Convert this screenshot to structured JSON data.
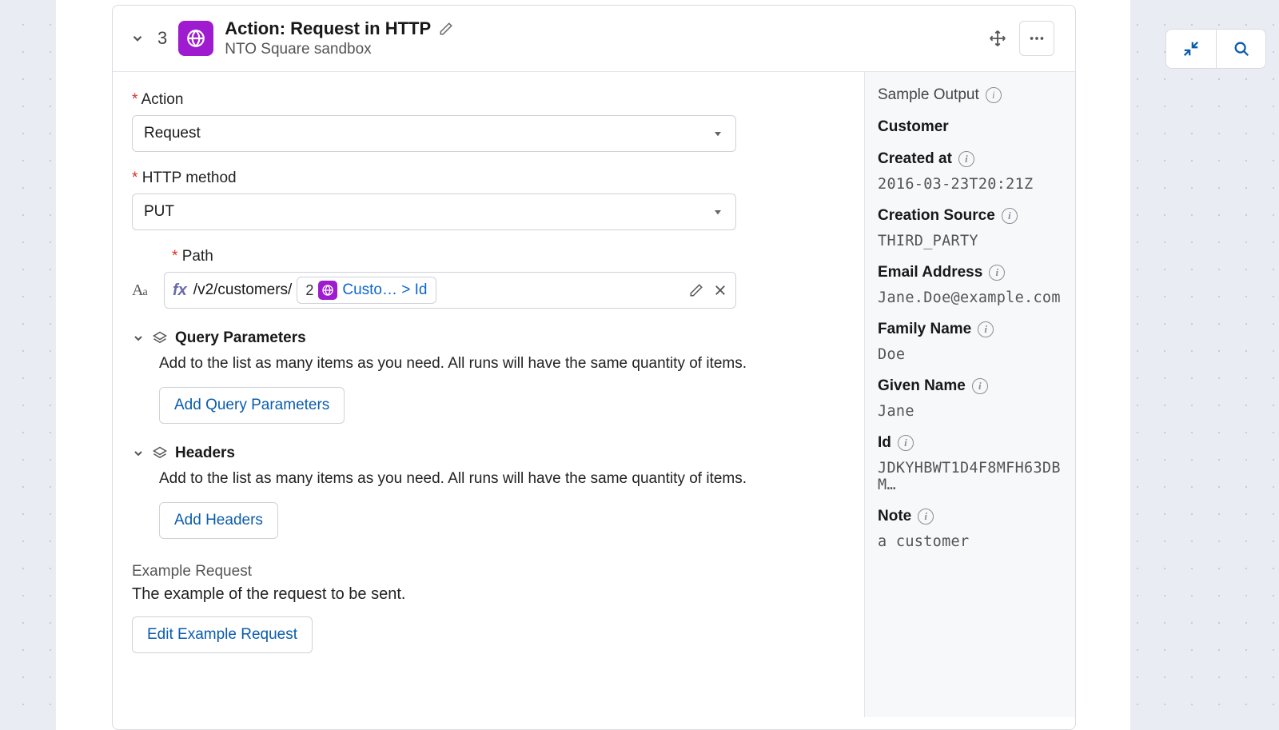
{
  "step": {
    "number": "3",
    "title": "Action: Request in HTTP",
    "subtitle": "NTO Square sandbox"
  },
  "form": {
    "action_label": "Action",
    "action_value": "Request",
    "http_method_label": "HTTP method",
    "http_method_value": "PUT",
    "path_label": "Path",
    "path_prefix": "/v2/customers/",
    "path_pill_step": "2",
    "path_pill_text": "Custo… > Id",
    "qp_label": "Query Parameters",
    "qp_desc": "Add to the list as many items as you need. All runs will have the same quantity of items.",
    "qp_button": "Add Query Parameters",
    "headers_label": "Headers",
    "headers_desc": "Add to the list as many items as you need. All runs will have the same quantity of items.",
    "headers_button": "Add Headers",
    "example_label": "Example Request",
    "example_desc": "The example of the request to be sent.",
    "example_button": "Edit Example Request"
  },
  "sample": {
    "title": "Sample Output",
    "heading": "Customer",
    "fields": [
      {
        "label": "Created at",
        "value": "2016-03-23T20:21Z"
      },
      {
        "label": "Creation Source",
        "value": "THIRD_PARTY"
      },
      {
        "label": "Email Address",
        "value": "Jane.Doe@example.com"
      },
      {
        "label": "Family Name",
        "value": "Doe"
      },
      {
        "label": "Given Name",
        "value": "Jane"
      },
      {
        "label": "Id",
        "value": "JDKYHBWT1D4F8MFH63DBM…"
      },
      {
        "label": "Note",
        "value": "a customer"
      }
    ]
  }
}
